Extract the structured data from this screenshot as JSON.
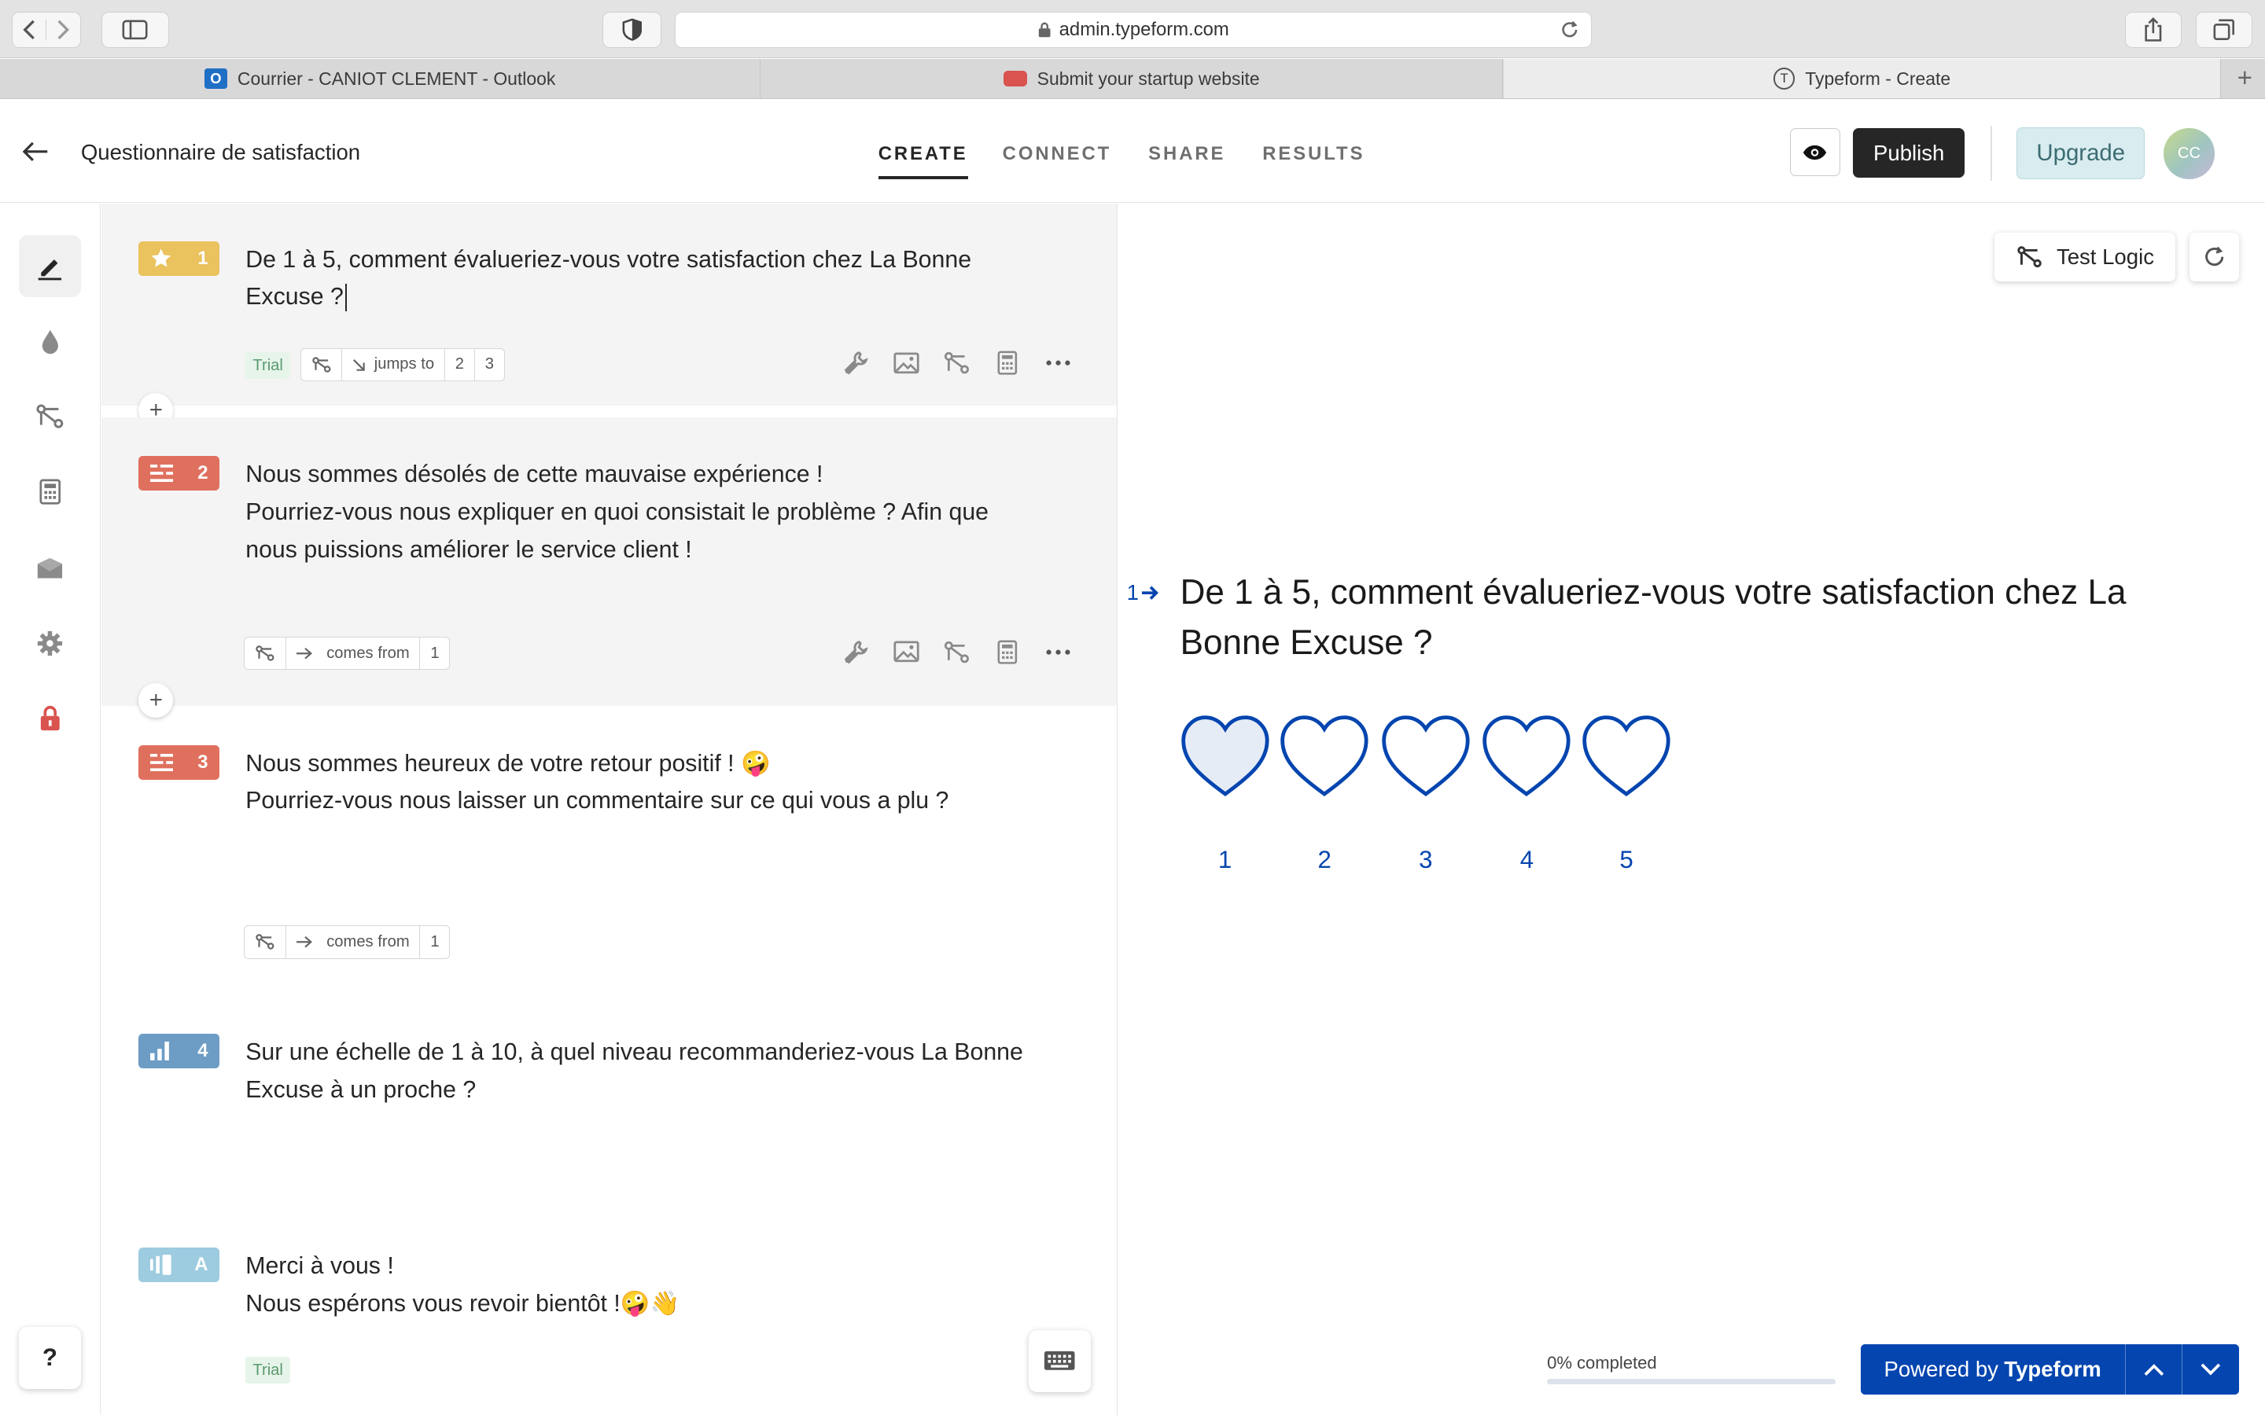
{
  "browser": {
    "url": "admin.typeform.com",
    "tabs": [
      {
        "label": "Courrier - CANIOT CLEMENT - Outlook",
        "icon": "outlook-icon"
      },
      {
        "label": "Submit your startup website",
        "icon": "bus-icon"
      },
      {
        "label": "Typeform - Create",
        "icon": "typeform-icon"
      }
    ]
  },
  "header": {
    "form_title": "Questionnaire de satisfaction",
    "tabs": [
      "CREATE",
      "CONNECT",
      "SHARE",
      "RESULTS"
    ],
    "publish_label": "Publish",
    "upgrade_label": "Upgrade",
    "avatar_initials": "CC"
  },
  "questions": [
    {
      "number": "1",
      "badge_color": "#eac25e",
      "icon": "star-icon",
      "text": [
        "De 1 à 5, comment évalueriez-vous votre satisfaction chez La Bonne",
        "Excuse ?"
      ],
      "trial_label": "Trial",
      "logic": {
        "label": "jumps to",
        "targets": [
          "2",
          "3"
        ]
      }
    },
    {
      "number": "2",
      "badge_color": "#e0705e",
      "icon": "long-text-icon",
      "text": [
        "Nous sommes désolés de cette mauvaise expérience !",
        "Pourriez-vous nous expliquer en quoi consistait le problème ? Afin que",
        "nous puissions améliorer le service client !"
      ],
      "logic": {
        "label": "comes from",
        "targets": [
          "1"
        ]
      }
    },
    {
      "number": "3",
      "badge_color": "#e0705e",
      "icon": "long-text-icon",
      "text": [
        "Nous sommes heureux de votre retour positif ! 🤪",
        "Pourriez-vous nous laisser un commentaire sur ce qui vous a plu ?"
      ],
      "logic": {
        "label": "comes from",
        "targets": [
          "1"
        ]
      }
    },
    {
      "number": "4",
      "badge_color": "#6d9cc5",
      "icon": "opinion-scale-icon",
      "text": [
        "Sur une échelle de 1 à 10, à quel niveau recommanderiez-vous La Bonne",
        "Excuse à un proche ?"
      ]
    },
    {
      "number": "A",
      "badge_color": "#9dcbdf",
      "icon": "end-screen-icon",
      "text": [
        "Merci à vous !",
        "Nous espérons vous revoir bientôt !🤪👋"
      ],
      "trial_label": "Trial"
    }
  ],
  "preview": {
    "test_logic_label": "Test Logic",
    "question_number": "1",
    "question_text": [
      "De 1 à 5, comment évalueriez-vous votre satisfaction chez La",
      "Bonne Excuse ?"
    ],
    "rating_options": [
      "1",
      "2",
      "3",
      "4",
      "5"
    ],
    "accent_color": "#0445af",
    "progress_text": "0% completed",
    "progress_value": 0,
    "powered_by": "Powered by",
    "brand": "Typeform"
  },
  "sidebar": {
    "help_label": "?"
  }
}
